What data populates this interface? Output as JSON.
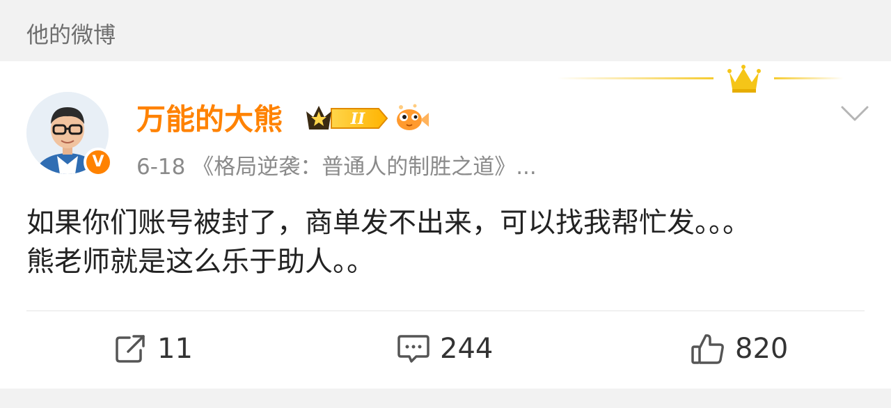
{
  "header": {
    "title": "他的微博"
  },
  "post": {
    "author": "万能的大熊",
    "vip_level": "II",
    "verified_mark": "V",
    "meta": "6-18 《格局逆袭：普通人的制胜之道》...",
    "text_lines": [
      "如果你们账号被封了，商单发不出来，可以找我帮忙发。。。",
      "熊老师就是这么乐于助人。。"
    ]
  },
  "actions": {
    "repost": {
      "count": "11",
      "icon": "share-icon"
    },
    "comment": {
      "count": "244",
      "icon": "comment-icon"
    },
    "like": {
      "count": "820",
      "icon": "thumbs-up-icon"
    }
  },
  "colors": {
    "brand_orange": "#ff8200",
    "gold": "#f5c518",
    "text_main": "#222222",
    "text_secondary": "#8a8a8a"
  }
}
